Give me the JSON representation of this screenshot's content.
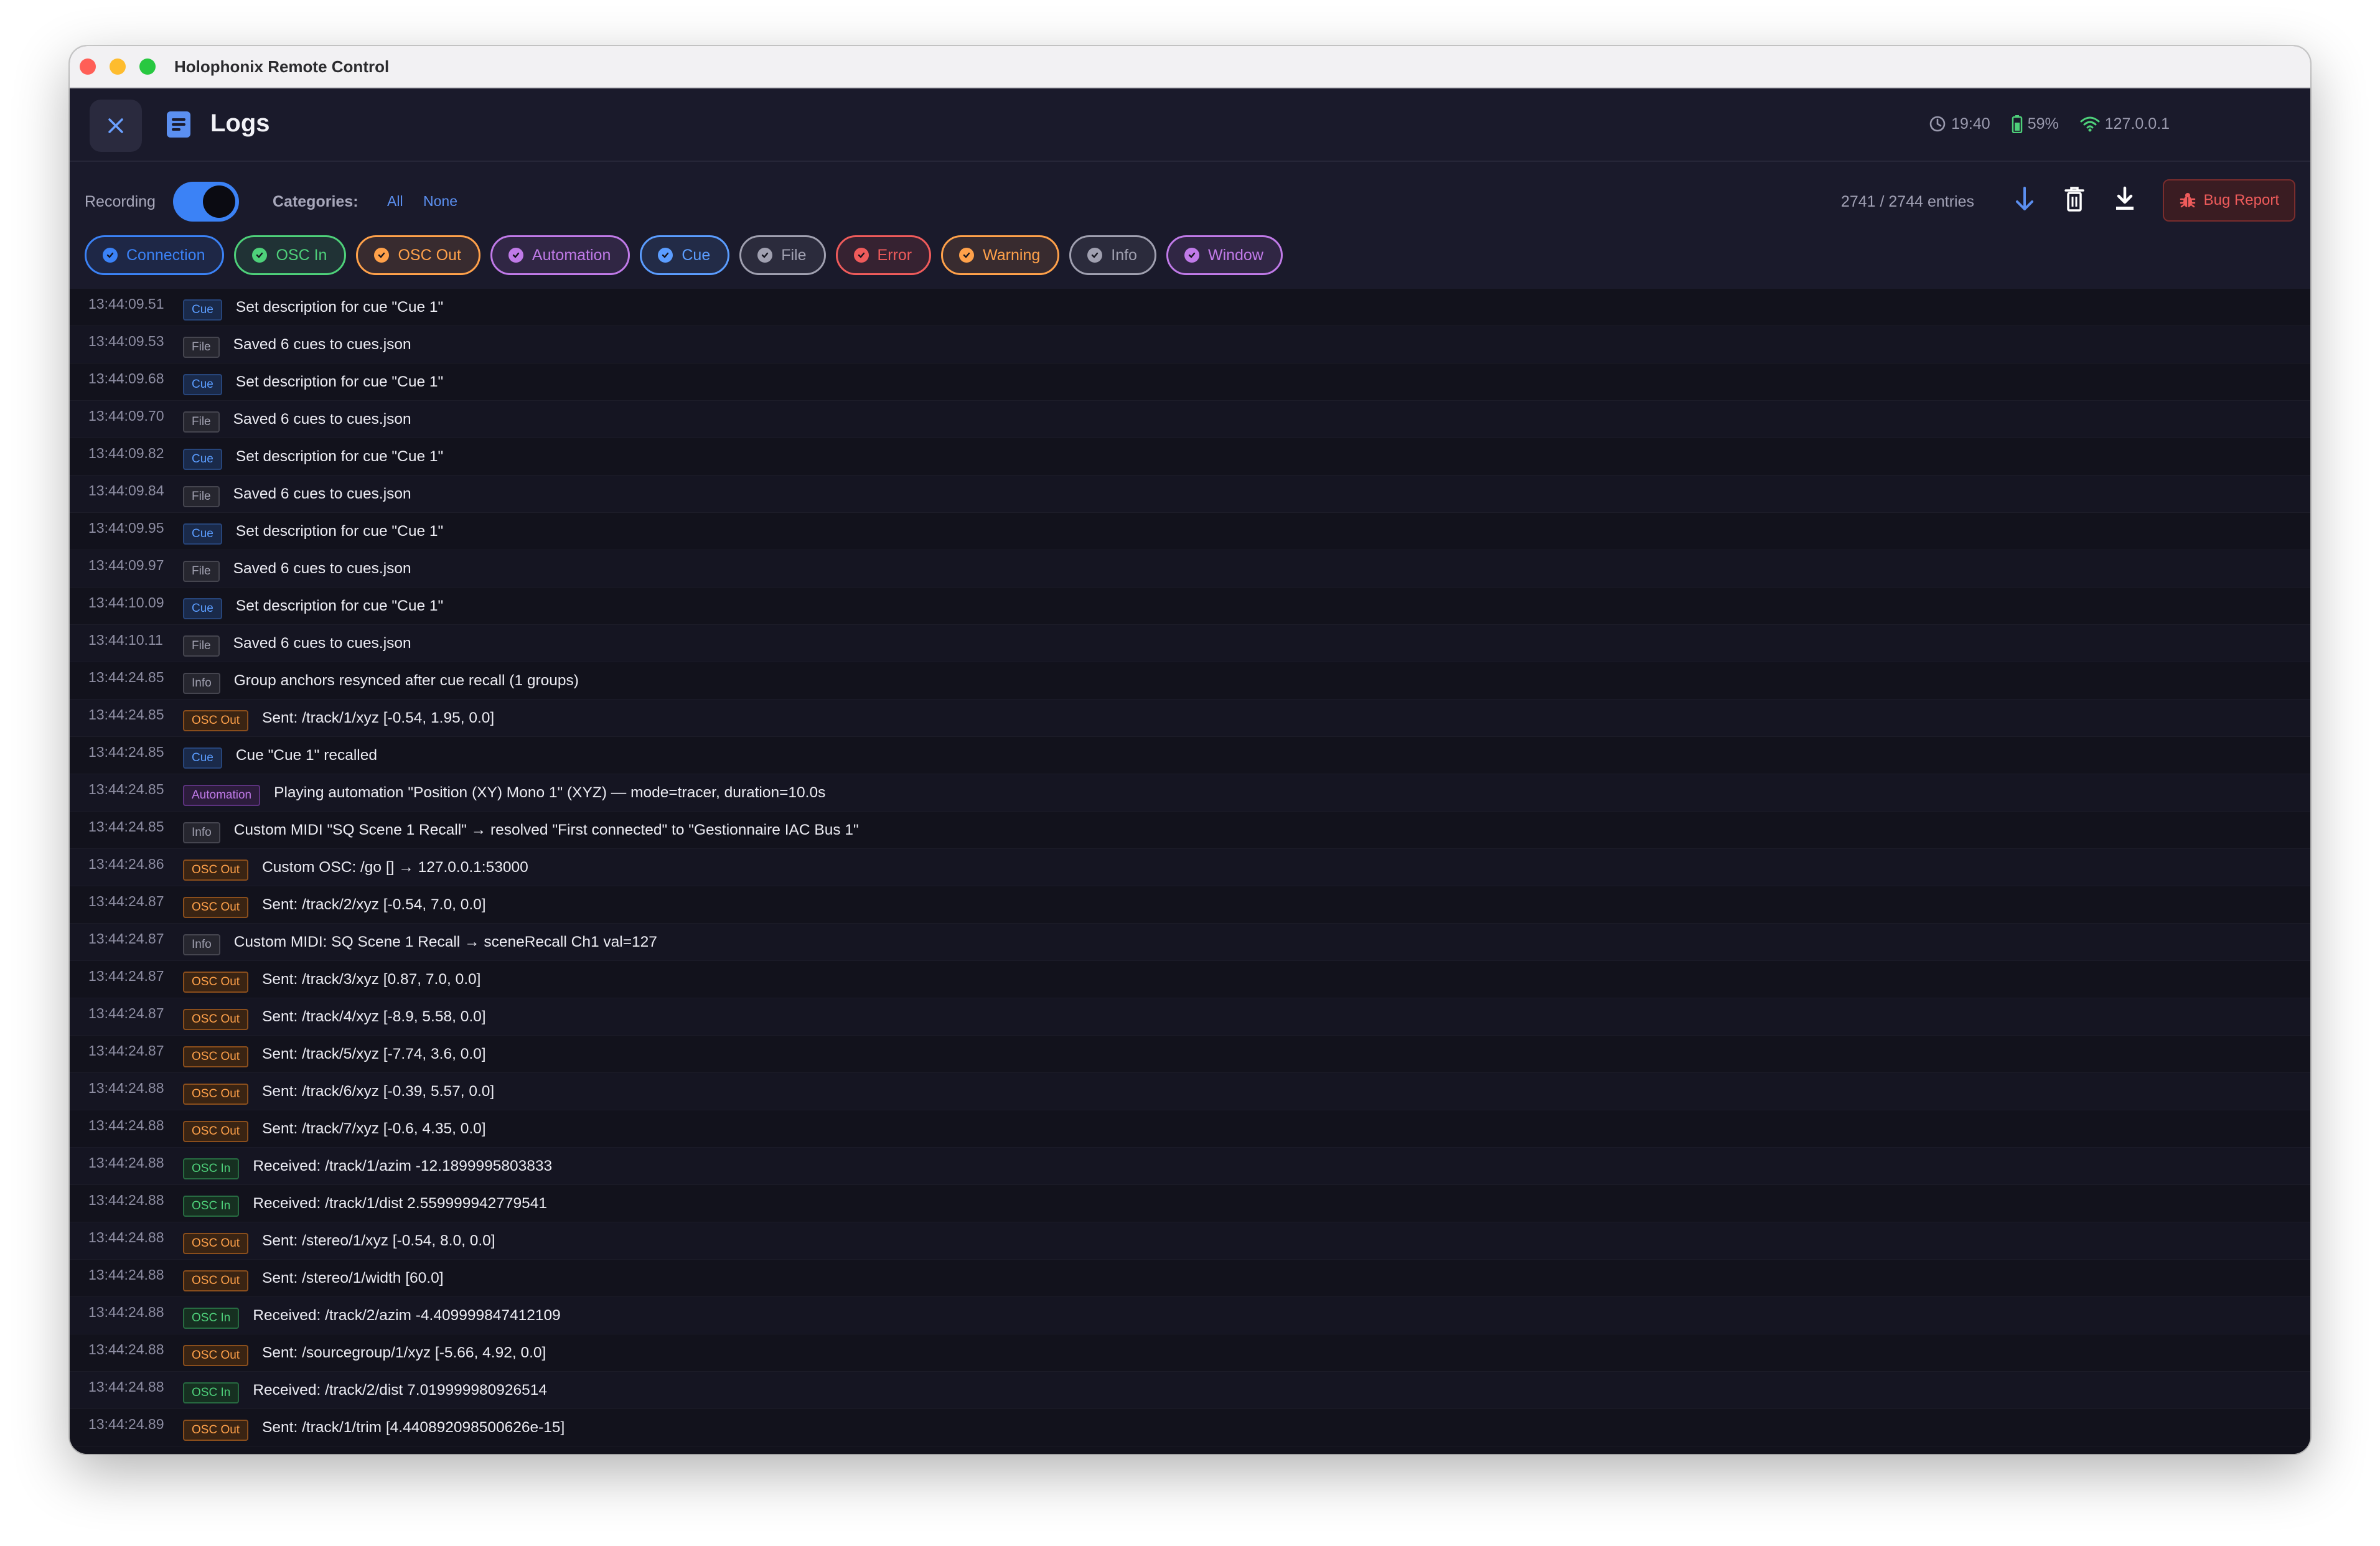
{
  "window": {
    "title": "Holophonix Remote Control"
  },
  "header": {
    "title": "Logs",
    "close_icon": "close-icon",
    "doc_icon": "document-icon",
    "status": {
      "time": "19:40",
      "battery": "59%",
      "ip": "127.0.0.1"
    }
  },
  "toolbar": {
    "recording_label": "Recording",
    "recording_on": true,
    "categories_label": "Categories:",
    "all_label": "All",
    "none_label": "None",
    "entries": "2741 / 2744 entries",
    "bug_report_label": "Bug Report"
  },
  "colors": {
    "accent": "#3b82f6",
    "connection": "#3b82f6",
    "osc_in": "#4ed07a",
    "osc_out": "#ffa14a",
    "automation": "#c07ae8",
    "cue": "#5b9dff",
    "file": "#a0a0b0",
    "error": "#ef5b5b",
    "warning": "#ffa14a",
    "info": "#a0a0b0",
    "window": "#c07ae8"
  },
  "filters": [
    {
      "label": "Connection",
      "key": "connection"
    },
    {
      "label": "OSC In",
      "key": "osc_in"
    },
    {
      "label": "OSC Out",
      "key": "osc_out"
    },
    {
      "label": "Automation",
      "key": "automation"
    },
    {
      "label": "Cue",
      "key": "cue"
    },
    {
      "label": "File",
      "key": "file"
    },
    {
      "label": "Error",
      "key": "error"
    },
    {
      "label": "Warning",
      "key": "warning"
    },
    {
      "label": "Info",
      "key": "info"
    },
    {
      "label": "Window",
      "key": "window"
    }
  ],
  "logs": [
    {
      "time": "13:44:09.51",
      "cat": "Cue",
      "msg": "Set description for cue \"Cue 1\""
    },
    {
      "time": "13:44:09.53",
      "cat": "File",
      "msg": "Saved 6 cues to cues.json"
    },
    {
      "time": "13:44:09.68",
      "cat": "Cue",
      "msg": "Set description for cue \"Cue 1\""
    },
    {
      "time": "13:44:09.70",
      "cat": "File",
      "msg": "Saved 6 cues to cues.json"
    },
    {
      "time": "13:44:09.82",
      "cat": "Cue",
      "msg": "Set description for cue \"Cue 1\""
    },
    {
      "time": "13:44:09.84",
      "cat": "File",
      "msg": "Saved 6 cues to cues.json"
    },
    {
      "time": "13:44:09.95",
      "cat": "Cue",
      "msg": "Set description for cue \"Cue 1\""
    },
    {
      "time": "13:44:09.97",
      "cat": "File",
      "msg": "Saved 6 cues to cues.json"
    },
    {
      "time": "13:44:10.09",
      "cat": "Cue",
      "msg": "Set description for cue \"Cue 1\""
    },
    {
      "time": "13:44:10.11",
      "cat": "File",
      "msg": "Saved 6 cues to cues.json"
    },
    {
      "time": "13:44:24.85",
      "cat": "Info",
      "msg": "Group anchors resynced after cue recall (1 groups)"
    },
    {
      "time": "13:44:24.85",
      "cat": "OSC Out",
      "msg": "Sent: /track/1/xyz [-0.54, 1.95, 0.0]"
    },
    {
      "time": "13:44:24.85",
      "cat": "Cue",
      "msg": "Cue \"Cue 1\" recalled"
    },
    {
      "time": "13:44:24.85",
      "cat": "Automation",
      "msg": "Playing automation \"Position (XY) Mono 1\" (XYZ) — mode=tracer, duration=10.0s"
    },
    {
      "time": "13:44:24.85",
      "cat": "Info",
      "msg": "Custom MIDI \"SQ Scene 1 Recall\" → resolved \"First connected\" to \"Gestionnaire IAC Bus 1\""
    },
    {
      "time": "13:44:24.86",
      "cat": "OSC Out",
      "msg": "Custom OSC: /go [] → 127.0.0.1:53000"
    },
    {
      "time": "13:44:24.87",
      "cat": "OSC Out",
      "msg": "Sent: /track/2/xyz [-0.54, 7.0, 0.0]"
    },
    {
      "time": "13:44:24.87",
      "cat": "Info",
      "msg": "Custom MIDI: SQ Scene 1 Recall → sceneRecall Ch1 val=127"
    },
    {
      "time": "13:44:24.87",
      "cat": "OSC Out",
      "msg": "Sent: /track/3/xyz [0.87, 7.0, 0.0]"
    },
    {
      "time": "13:44:24.87",
      "cat": "OSC Out",
      "msg": "Sent: /track/4/xyz [-8.9, 5.58, 0.0]"
    },
    {
      "time": "13:44:24.87",
      "cat": "OSC Out",
      "msg": "Sent: /track/5/xyz [-7.74, 3.6, 0.0]"
    },
    {
      "time": "13:44:24.88",
      "cat": "OSC Out",
      "msg": "Sent: /track/6/xyz [-0.39, 5.57, 0.0]"
    },
    {
      "time": "13:44:24.88",
      "cat": "OSC Out",
      "msg": "Sent: /track/7/xyz [-0.6, 4.35, 0.0]"
    },
    {
      "time": "13:44:24.88",
      "cat": "OSC In",
      "msg": "Received: /track/1/azim -12.1899995803833"
    },
    {
      "time": "13:44:24.88",
      "cat": "OSC In",
      "msg": "Received: /track/1/dist 2.559999942779541"
    },
    {
      "time": "13:44:24.88",
      "cat": "OSC Out",
      "msg": "Sent: /stereo/1/xyz [-0.54, 8.0, 0.0]"
    },
    {
      "time": "13:44:24.88",
      "cat": "OSC Out",
      "msg": "Sent: /stereo/1/width [60.0]"
    },
    {
      "time": "13:44:24.88",
      "cat": "OSC In",
      "msg": "Received: /track/2/azim -4.409999847412109"
    },
    {
      "time": "13:44:24.88",
      "cat": "OSC Out",
      "msg": "Sent: /sourcegroup/1/xyz [-5.66, 4.92, 0.0]"
    },
    {
      "time": "13:44:24.88",
      "cat": "OSC In",
      "msg": "Received: /track/2/dist 7.019999980926514"
    },
    {
      "time": "13:44:24.89",
      "cat": "OSC Out",
      "msg": "Sent: /track/1/trim [4.440892098500626e-15]"
    }
  ]
}
